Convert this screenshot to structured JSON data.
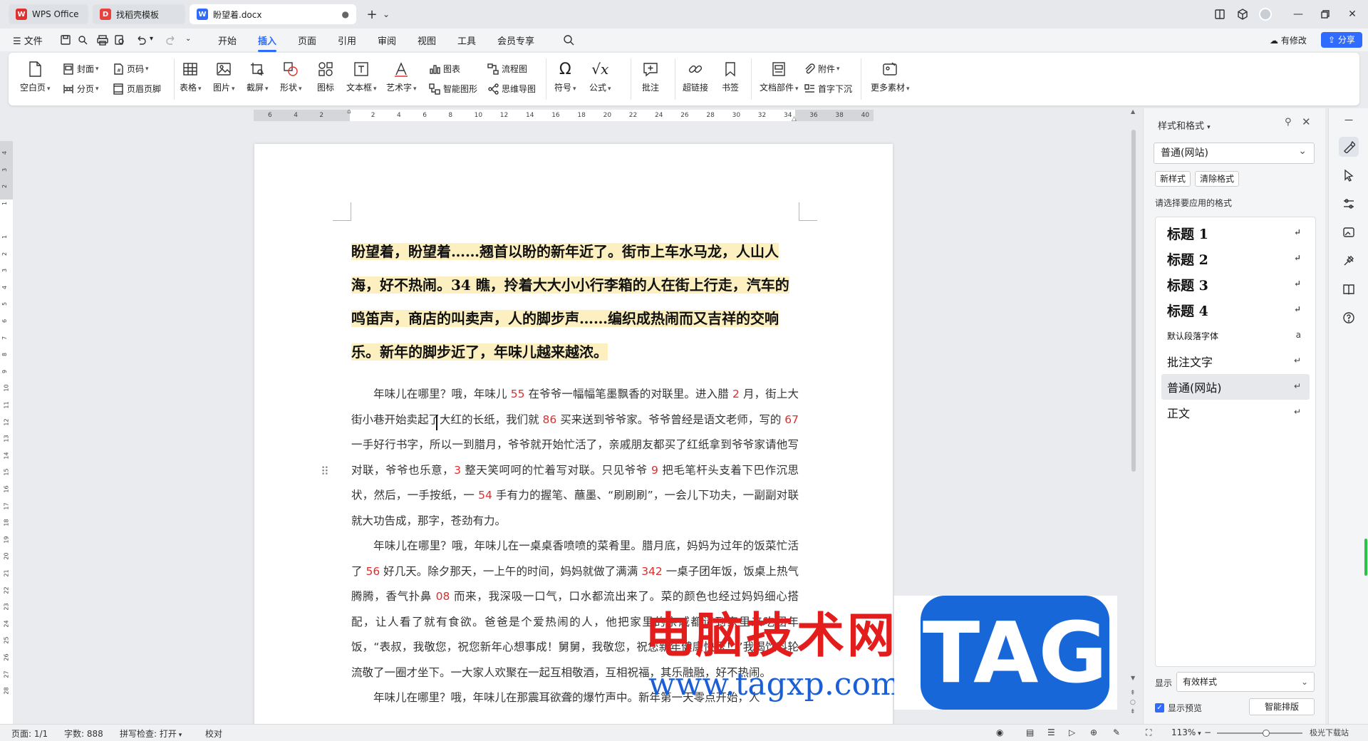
{
  "titlebar": {
    "tabs": [
      {
        "label": "WPS Office",
        "logo": "W"
      },
      {
        "label": "找稻壳模板",
        "logo": "D"
      },
      {
        "label": "盼望着.docx",
        "logo": "W"
      }
    ],
    "new_tab": "+",
    "tab_list": "⌄"
  },
  "menubar": {
    "file": "文件",
    "tabs": [
      "开始",
      "插入",
      "页面",
      "引用",
      "审阅",
      "视图",
      "工具",
      "会员专享"
    ],
    "active_tab": "插入",
    "has_changes": "有修改",
    "share": "分享"
  },
  "ribbon": {
    "blank_page": "空白页",
    "cover": "封面",
    "page_break": "分页",
    "page_number": "页码",
    "header_footer": "页眉页脚",
    "table": "表格",
    "picture": "图片",
    "screenshot": "截屏",
    "shape": "形状",
    "icons": "图标",
    "textbox": "文本框",
    "wordart": "艺术字",
    "chart": "图表",
    "smart_graphic": "智能图形",
    "flowchart": "流程图",
    "mindmap": "思维导图",
    "symbol": "符号",
    "formula": "公式",
    "comment": "批注",
    "hyperlink": "超链接",
    "bookmark": "书签",
    "doc_parts": "文档部件",
    "attachment": "附件",
    "drop_cap": "首字下沉",
    "more_material": "更多素材"
  },
  "ruler": {
    "h_ticks": [
      "6",
      "4",
      "2",
      "",
      "2",
      "4",
      "6",
      "8",
      "10",
      "12",
      "14",
      "16",
      "18",
      "20",
      "22",
      "24",
      "26",
      "28",
      "30",
      "32",
      "34",
      "36",
      "38",
      "40"
    ],
    "v_ticks": [
      "4",
      "3",
      "2",
      "1",
      "",
      "1",
      "2",
      "3",
      "4",
      "5",
      "6",
      "7",
      "8",
      "9",
      "10",
      "11",
      "12",
      "13",
      "14",
      "15",
      "16",
      "17",
      "18",
      "19",
      "20",
      "21",
      "22",
      "23",
      "24",
      "25",
      "26",
      "27",
      "28"
    ]
  },
  "document": {
    "heading": "盼望着，盼望着……翘首以盼的新年近了。街市上车水马龙，人山人海，好不热闹。34 瞧，拎着大大小小行李箱的人在街上行走，汽车的鸣笛声，商店的叫卖声，人的脚步声……编织成热闹而又吉祥的交响乐。新年的脚步近了，年味儿越来越浓。",
    "p1": [
      {
        "t": "年味儿在哪里？哦，年味儿 "
      },
      {
        "t": "55",
        "n": true
      },
      {
        "t": " 在爷爷一幅幅笔墨飘香的对联里。进入腊 "
      },
      {
        "t": "2",
        "n": true
      },
      {
        "t": " 月，街上大街小巷开始卖起了大红的长纸，我们就 "
      },
      {
        "t": "86",
        "n": true
      },
      {
        "t": " 买来送到爷爷家。爷爷曾经是语文老师，写的 "
      },
      {
        "t": "67",
        "n": true
      },
      {
        "t": " 一手好行书字，所以一到腊月，爷爷就开始忙活了，亲戚朋友都买了红纸拿到爷爷家请他写对联，爷爷也乐意，"
      },
      {
        "t": "3",
        "n": true
      },
      {
        "t": " 整天笑呵呵的忙着写对联。只见爷爷 "
      },
      {
        "t": "9",
        "n": true
      },
      {
        "t": " 把毛笔杆头支着下巴作沉思状，然后，一手按纸，一 "
      },
      {
        "t": "54",
        "n": true
      },
      {
        "t": " 手有力的握笔、蘸墨、“刷刷刷”，一会儿下功夫，一副副对联就大功告成，那字，苍劲有力。"
      }
    ],
    "p2": [
      {
        "t": "年味儿在哪里？哦，年味儿在一桌桌香喷喷的菜肴里。腊月底，妈妈为过年的饭菜忙活了 "
      },
      {
        "t": "56",
        "n": true
      },
      {
        "t": " 好几天。除夕那天，一上午的时间，妈妈就做了满满 "
      },
      {
        "t": "342",
        "n": true
      },
      {
        "t": " 一桌子团年饭，饭桌上热气腾腾，香气扑鼻 "
      },
      {
        "t": "08",
        "n": true
      },
      {
        "t": " 而来，我深吸一口气，口水都流出来了。菜的颜色也经过妈妈细心搭配，让人看了就有食欲。爸爸是个爱热闹的人，他把家里的亲戚都请到家里来吃团年饭，“表叔，我敬您，祝您新年心想事成！舅舅，我敬您，祝您新年健康快乐！”我喝饮料轮流敬了一圈才坐下。一大家人欢聚在一起互相敬酒，互相祝福，其乐融融，好不热闹。"
      }
    ],
    "p3": "年味儿在哪里？哦，年味儿在那震耳欲聋的爆竹声中。新年第一天零点开始，人"
  },
  "watermark": {
    "site_name": "电脑技术网",
    "url": "www.tagxp.com",
    "badge": "TAG",
    "corner": "极光下载站"
  },
  "panel": {
    "title": "样式和格式",
    "current_style": "普通(网站)",
    "new_style": "新样式",
    "clear_format": "清除格式",
    "prompt": "请选择要应用的格式",
    "styles": [
      {
        "label": "标题 1",
        "kind": "h"
      },
      {
        "label": "标题 2",
        "kind": "h"
      },
      {
        "label": "标题 3",
        "kind": "h"
      },
      {
        "label": "标题 4",
        "kind": "h"
      },
      {
        "label": "默认段落字体",
        "kind": "small"
      },
      {
        "label": "批注文字",
        "kind": "mid"
      },
      {
        "label": "普通(网站)",
        "kind": "mid"
      },
      {
        "label": "正文",
        "kind": "mid"
      }
    ],
    "selected_style": "普通(网站)",
    "show_label": "显示",
    "show_value": "有效样式",
    "show_preview": "显示预览",
    "smart_layout": "智能排版"
  },
  "statusbar": {
    "page": "页面: 1/1",
    "words": "字数: 888",
    "spell": "拼写检查: 打开",
    "proof": "校对",
    "zoom": "113%"
  }
}
